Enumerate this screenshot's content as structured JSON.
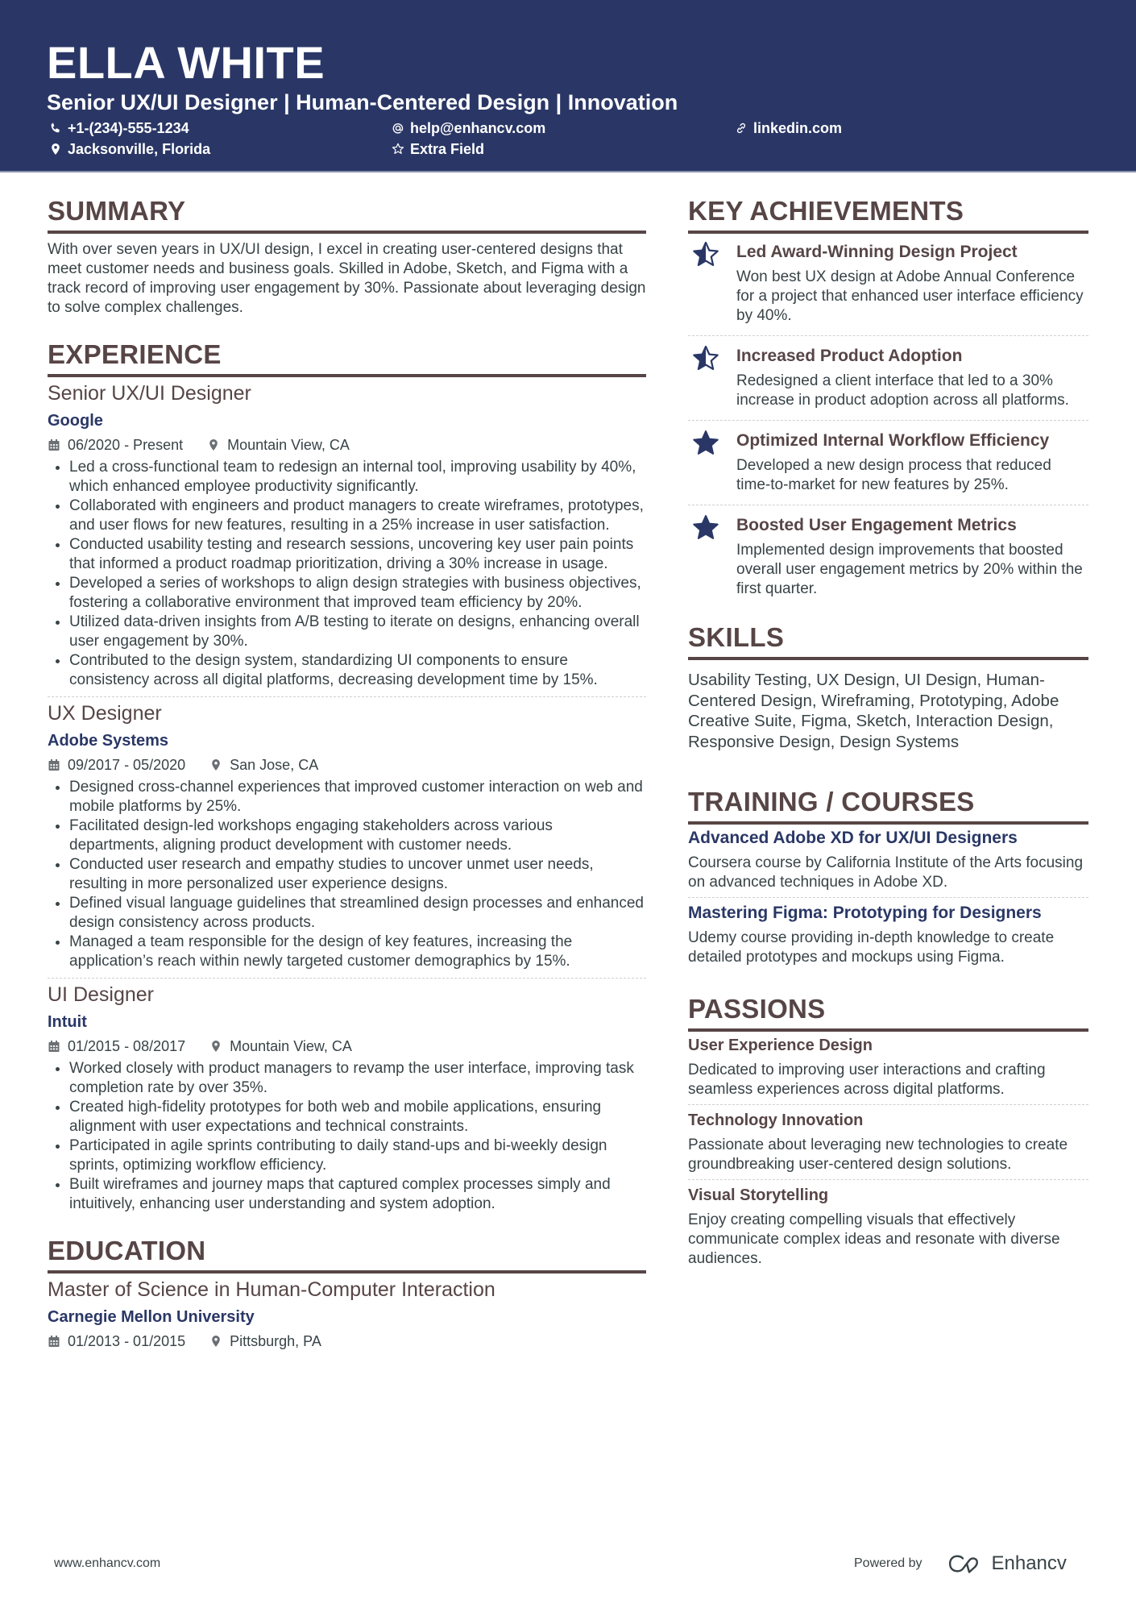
{
  "header": {
    "name": "ELLA WHITE",
    "headline": "Senior UX/UI Designer | Human-Centered Design | Innovation",
    "contacts": {
      "phone": {
        "icon": "phone-icon",
        "text": "+1-(234)-555-1234"
      },
      "email": {
        "icon": "at-icon",
        "text": "help@enhancv.com"
      },
      "link": {
        "icon": "link-icon",
        "text": "linkedin.com"
      },
      "location": {
        "icon": "location-pin-icon",
        "text": "Jacksonville, Florida"
      },
      "extra": {
        "icon": "star-outline-icon",
        "text": "Extra Field"
      }
    }
  },
  "colors": {
    "header_bg": "#2a3766",
    "heading": "#574546",
    "accent": "#2a3766",
    "body": "#384347"
  },
  "summary": {
    "title": "SUMMARY",
    "text": "With over seven years in UX/UI design, I excel in creating user-centered designs that meet customer needs and business goals. Skilled in Adobe, Sketch, and Figma with a track record of improving user engagement by 30%. Passionate about leveraging design to solve complex challenges."
  },
  "experience": {
    "title": "EXPERIENCE",
    "jobs": [
      {
        "role": "Senior UX/UI Designer",
        "company": "Google",
        "dates": "06/2020 - Present",
        "location": "Mountain View, CA",
        "bullets": [
          "Led a cross-functional team to redesign an internal tool, improving usability by 40%, which enhanced employee productivity significantly.",
          "Collaborated with engineers and product managers to create wireframes, prototypes, and user flows for new features, resulting in a 25% increase in user satisfaction.",
          "Conducted usability testing and research sessions, uncovering key user pain points that informed a product roadmap prioritization, driving a 30% increase in usage.",
          "Developed a series of workshops to align design strategies with business objectives, fostering a collaborative environment that improved team efficiency by 20%.",
          "Utilized data-driven insights from A/B testing to iterate on designs, enhancing overall user engagement by 30%.",
          "Contributed to the design system, standardizing UI components to ensure consistency across all digital platforms, decreasing development time by 15%."
        ]
      },
      {
        "role": "UX Designer",
        "company": "Adobe Systems",
        "dates": "09/2017 - 05/2020",
        "location": "San Jose, CA",
        "bullets": [
          "Designed cross-channel experiences that improved customer interaction on web and mobile platforms by 25%.",
          "Facilitated design-led workshops engaging stakeholders across various departments, aligning product development with customer needs.",
          "Conducted user research and empathy studies to uncover unmet user needs, resulting in more personalized user experience designs.",
          "Defined visual language guidelines that streamlined design processes and enhanced design consistency across products.",
          "Managed a team responsible for the design of key features, increasing the application’s reach within newly targeted customer demographics by 15%."
        ]
      },
      {
        "role": "UI Designer",
        "company": "Intuit",
        "dates": "01/2015 - 08/2017",
        "location": "Mountain View, CA",
        "bullets": [
          "Worked closely with product managers to revamp the user interface, improving task completion rate by over 35%.",
          "Created high-fidelity prototypes for both web and mobile applications, ensuring alignment with user expectations and technical constraints.",
          "Participated in agile sprints contributing to daily stand-ups and bi-weekly design sprints, optimizing workflow efficiency.",
          "Built wireframes and journey maps that captured complex processes simply and intuitively, enhancing user understanding and system adoption."
        ]
      }
    ]
  },
  "education": {
    "title": "EDUCATION",
    "degree": "Master of Science in Human-Computer Interaction",
    "school": "Carnegie Mellon University",
    "dates": "01/2013 - 01/2015",
    "location": "Pittsburgh, PA"
  },
  "achievements": {
    "title": "KEY ACHIEVEMENTS",
    "items": [
      {
        "icon": "star-half-icon",
        "title": "Led Award-Winning Design Project",
        "desc": "Won best UX design at Adobe Annual Conference for a project that enhanced user interface efficiency by 40%."
      },
      {
        "icon": "star-half-icon",
        "title": "Increased Product Adoption",
        "desc": "Redesigned a client interface that led to a 30% increase in product adoption across all platforms."
      },
      {
        "icon": "star-filled-icon",
        "title": "Optimized Internal Workflow Efficiency",
        "desc": "Developed a new design process that reduced time-to-market for new features by 25%."
      },
      {
        "icon": "star-filled-icon",
        "title": "Boosted User Engagement Metrics",
        "desc": "Implemented design improvements that boosted overall user engagement metrics by 20% within the first quarter."
      }
    ]
  },
  "skills": {
    "title": "SKILLS",
    "text": "Usability Testing, UX Design, UI Design, Human-Centered Design, Wireframing, Prototyping, Adobe Creative Suite, Figma, Sketch, Interaction Design, Responsive Design, Design Systems"
  },
  "training": {
    "title": "TRAINING / COURSES",
    "items": [
      {
        "title": "Advanced Adobe XD for UX/UI Designers",
        "desc": "Coursera course by California Institute of the Arts focusing on advanced techniques in Adobe XD."
      },
      {
        "title": "Mastering Figma: Prototyping for Designers",
        "desc": "Udemy course providing in-depth knowledge to create detailed prototypes and mockups using Figma."
      }
    ]
  },
  "passions": {
    "title": "PASSIONS",
    "items": [
      {
        "title": "User Experience Design",
        "desc": "Dedicated to improving user interactions and crafting seamless experiences across digital platforms."
      },
      {
        "title": "Technology Innovation",
        "desc": "Passionate about leveraging new technologies to create groundbreaking user-centered design solutions."
      },
      {
        "title": "Visual Storytelling",
        "desc": "Enjoy creating compelling visuals that effectively communicate complex ideas and resonate with diverse audiences."
      }
    ]
  },
  "footer": {
    "website": "www.enhancv.com",
    "powered_by": "Powered by",
    "brand": "Enhancv"
  }
}
